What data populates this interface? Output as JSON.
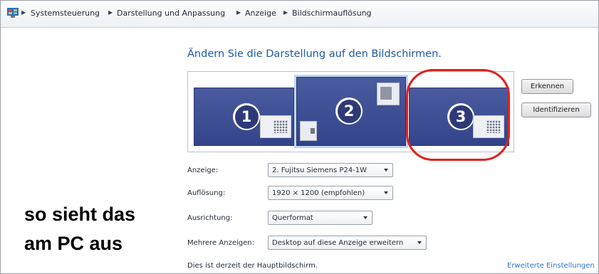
{
  "breadcrumb": {
    "items": [
      "Systemsteuerung",
      "Darstellung und Anpassung",
      "Anzeige",
      "Bildschirmauflösung"
    ]
  },
  "heading": "Ändern Sie die Darstellung auf den Bildschirmen.",
  "monitors": [
    {
      "number": "1",
      "selected": false
    },
    {
      "number": "2",
      "selected": true
    },
    {
      "number": "3",
      "selected": false,
      "highlighted": true
    }
  ],
  "buttons": {
    "detect": "Erkennen",
    "identify": "Identifizieren"
  },
  "settings": {
    "display_label": "Anzeige:",
    "display_value": "2. Fujitsu Siemens P24-1W",
    "resolution_label": "Auflösung:",
    "resolution_value": "1920 × 1200 (empfohlen)",
    "orientation_label": "Ausrichtung:",
    "orientation_value": "Querformat",
    "multi_label": "Mehrere Anzeigen:",
    "multi_value": "Desktop auf diese Anzeige erweitern"
  },
  "status": "Dies ist derzeit der Hauptbildschirm.",
  "advanced_link": "Erweiterte Einstellungen",
  "caption": {
    "line1": "so sieht das",
    "line2": "am PC aus"
  },
  "colors": {
    "highlight": "#e21f1f",
    "link": "#2c73c9",
    "heading": "#1e5aa6",
    "monitor": "#3d4f94"
  }
}
